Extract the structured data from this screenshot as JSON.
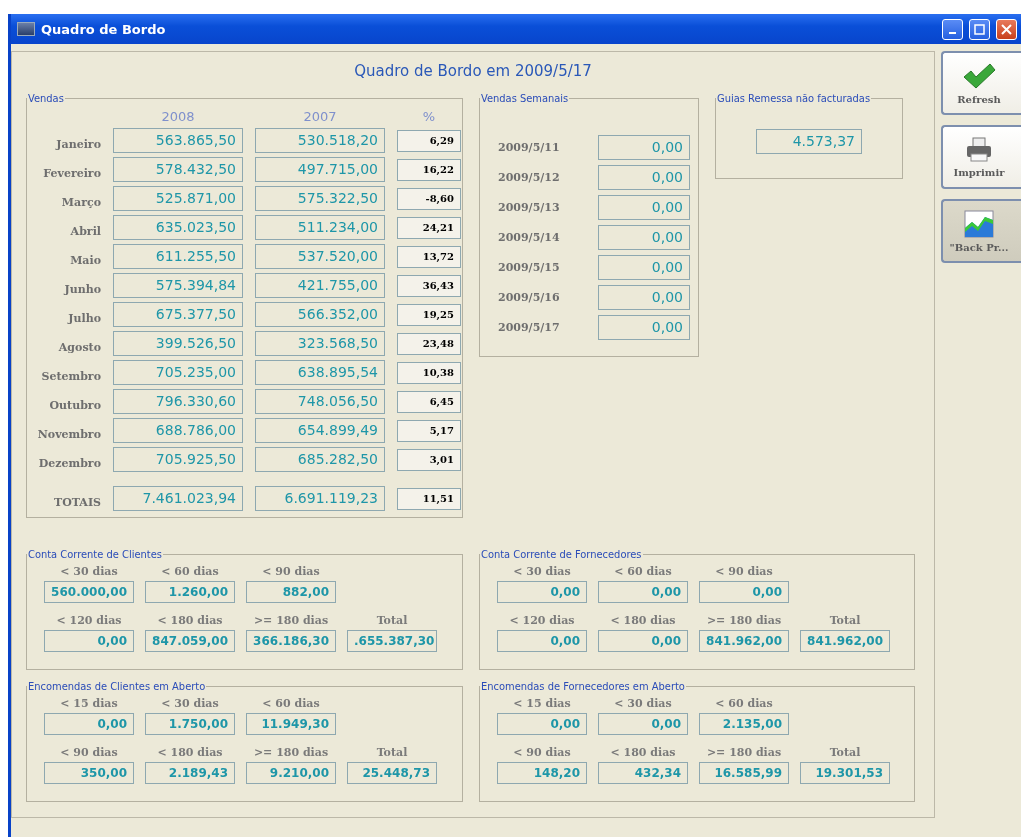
{
  "window": {
    "title": "Quadro de Bordo"
  },
  "header": "Quadro de Bordo em 2009/5/17",
  "vendas": {
    "title": "Vendas",
    "columns": [
      "2008",
      "2007",
      "%"
    ],
    "rows": [
      {
        "month": "Janeiro",
        "current": "563.865,50",
        "previous": "530.518,20",
        "pct": "6,29"
      },
      {
        "month": "Fevereiro",
        "current": "578.432,50",
        "previous": "497.715,00",
        "pct": "16,22"
      },
      {
        "month": "Março",
        "current": "525.871,00",
        "previous": "575.322,50",
        "pct": "-8,60"
      },
      {
        "month": "Abril",
        "current": "635.023,50",
        "previous": "511.234,00",
        "pct": "24,21"
      },
      {
        "month": "Maio",
        "current": "611.255,50",
        "previous": "537.520,00",
        "pct": "13,72"
      },
      {
        "month": "Junho",
        "current": "575.394,84",
        "previous": "421.755,00",
        "pct": "36,43"
      },
      {
        "month": "Julho",
        "current": "675.377,50",
        "previous": "566.352,00",
        "pct": "19,25"
      },
      {
        "month": "Agosto",
        "current": "399.526,50",
        "previous": "323.568,50",
        "pct": "23,48"
      },
      {
        "month": "Setembro",
        "current": "705.235,00",
        "previous": "638.895,54",
        "pct": "10,38"
      },
      {
        "month": "Outubro",
        "current": "796.330,60",
        "previous": "748.056,50",
        "pct": "6,45"
      },
      {
        "month": "Novembro",
        "current": "688.786,00",
        "previous": "654.899,49",
        "pct": "5,17"
      },
      {
        "month": "Dezembro",
        "current": "705.925,50",
        "previous": "685.282,50",
        "pct": "3,01"
      }
    ],
    "totals": {
      "label": "TOTAIS",
      "current": "7.461.023,94",
      "previous": "6.691.119,23",
      "pct": "11,51"
    }
  },
  "vendas_semanais": {
    "title": "Vendas Semanais",
    "rows": [
      {
        "date": "2009/5/11",
        "value": "0,00"
      },
      {
        "date": "2009/5/12",
        "value": "0,00"
      },
      {
        "date": "2009/5/13",
        "value": "0,00"
      },
      {
        "date": "2009/5/14",
        "value": "0,00"
      },
      {
        "date": "2009/5/15",
        "value": "0,00"
      },
      {
        "date": "2009/5/16",
        "value": "0,00"
      },
      {
        "date": "2009/5/17",
        "value": "0,00"
      }
    ]
  },
  "guias": {
    "title": "Guias Remessa não facturadas",
    "value": "4.573,37"
  },
  "aging_panels": [
    {
      "title": "Conta Corrente de Clientes",
      "rows": [
        [
          {
            "label": "< 30 dias",
            "value": "560.000,00"
          },
          {
            "label": "< 60 dias",
            "value": "1.260,00"
          },
          {
            "label": "< 90 dias",
            "value": "882,00"
          }
        ],
        [
          {
            "label": "< 120 dias",
            "value": "0,00"
          },
          {
            "label": "< 180 dias",
            "value": "847.059,00"
          },
          {
            "label": ">= 180 dias",
            "value": "366.186,30"
          },
          {
            "label": "Total",
            "value": ".655.387,30"
          }
        ]
      ]
    },
    {
      "title": "Conta Corrente de Fornecedores",
      "rows": [
        [
          {
            "label": "< 30 dias",
            "value": "0,00"
          },
          {
            "label": "< 60 dias",
            "value": "0,00"
          },
          {
            "label": "< 90 dias",
            "value": "0,00"
          }
        ],
        [
          {
            "label": "< 120 dias",
            "value": "0,00"
          },
          {
            "label": "< 180 dias",
            "value": "0,00"
          },
          {
            "label": ">= 180 dias",
            "value": "841.962,00"
          },
          {
            "label": "Total",
            "value": "841.962,00"
          }
        ]
      ]
    },
    {
      "title": "Encomendas de Clientes em Aberto",
      "rows": [
        [
          {
            "label": "< 15 dias",
            "value": "0,00"
          },
          {
            "label": "< 30 dias",
            "value": "1.750,00"
          },
          {
            "label": "< 60 dias",
            "value": "11.949,30"
          }
        ],
        [
          {
            "label": "< 90 dias",
            "value": "350,00"
          },
          {
            "label": "< 180 dias",
            "value": "2.189,43"
          },
          {
            "label": ">= 180 dias",
            "value": "9.210,00"
          },
          {
            "label": "Total",
            "value": "25.448,73"
          }
        ]
      ]
    },
    {
      "title": "Encomendas de Fornecedores em Aberto",
      "rows": [
        [
          {
            "label": "< 15 dias",
            "value": "0,00"
          },
          {
            "label": "< 30 dias",
            "value": "0,00"
          },
          {
            "label": "< 60 dias",
            "value": "2.135,00"
          }
        ],
        [
          {
            "label": "< 90 dias",
            "value": "148,20"
          },
          {
            "label": "< 180 dias",
            "value": "432,34"
          },
          {
            "label": ">= 180 dias",
            "value": "16.585,99"
          },
          {
            "label": "Total",
            "value": "19.301,53"
          }
        ]
      ]
    }
  ],
  "buttons": [
    {
      "label": "Refresh",
      "kind": "check",
      "pressed": false
    },
    {
      "label": "Imprimir",
      "kind": "printer",
      "pressed": false
    },
    {
      "label": "\"Back Pr...",
      "kind": "chart",
      "pressed": true
    }
  ]
}
